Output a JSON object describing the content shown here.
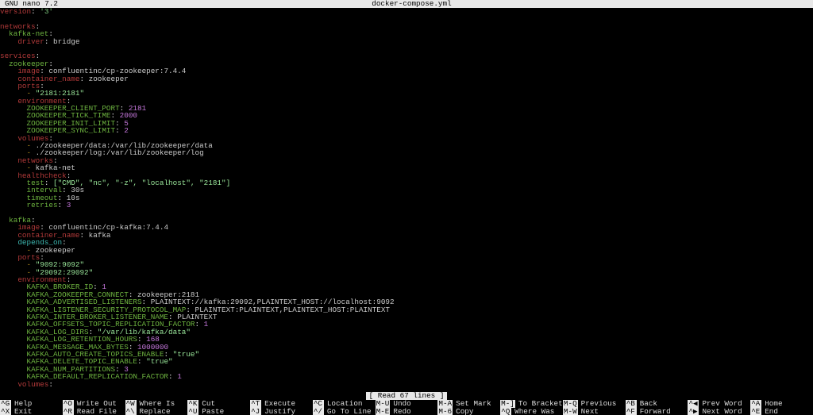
{
  "titlebar": {
    "app": "GNU nano 7.2",
    "filename": "docker-compose.yml"
  },
  "status": {
    "message": "[ Read 67 lines ]"
  },
  "shortcuts": {
    "row1": [
      {
        "key": "^G",
        "label": "Help"
      },
      {
        "key": "^O",
        "label": "Write Out"
      },
      {
        "key": "^W",
        "label": "Where Is"
      },
      {
        "key": "^K",
        "label": "Cut"
      },
      {
        "key": "^T",
        "label": "Execute"
      },
      {
        "key": "^C",
        "label": "Location"
      },
      {
        "key": "M-U",
        "label": "Undo"
      },
      {
        "key": "M-A",
        "label": "Set Mark"
      },
      {
        "key": "M-]",
        "label": "To Bracket"
      },
      {
        "key": "M-Q",
        "label": "Previous"
      },
      {
        "key": "^B",
        "label": "Back"
      },
      {
        "key": "^◀",
        "label": "Prev Word"
      },
      {
        "key": "^A",
        "label": "Home"
      }
    ],
    "row2": [
      {
        "key": "^X",
        "label": "Exit"
      },
      {
        "key": "^R",
        "label": "Read File"
      },
      {
        "key": "^\\",
        "label": "Replace"
      },
      {
        "key": "^U",
        "label": "Paste"
      },
      {
        "key": "^J",
        "label": "Justify"
      },
      {
        "key": "^/",
        "label": "Go To Line"
      },
      {
        "key": "M-E",
        "label": "Redo"
      },
      {
        "key": "M-6",
        "label": "Copy"
      },
      {
        "key": "^Q",
        "label": "Where Was"
      },
      {
        "key": "M-W",
        "label": "Next"
      },
      {
        "key": "^F",
        "label": "Forward"
      },
      {
        "key": "^▶",
        "label": "Next Word"
      },
      {
        "key": "^E",
        "label": "End"
      }
    ]
  },
  "lines": [
    {
      "t": "version: '3'",
      "key": "version",
      "sep": ": ",
      "val": "'3'",
      "kc": "k-red",
      "vc": "v-grn",
      "caret_after_key": true
    },
    {
      "t": ""
    },
    {
      "t": "networks:",
      "key": "networks",
      "sep": ":",
      "kc": "k-red"
    },
    {
      "t": "  kafka-net:",
      "indent": 2,
      "key": "kafka-net",
      "sep": ":",
      "kc": "k-green"
    },
    {
      "t": "    driver: bridge",
      "indent": 4,
      "key": "driver",
      "sep": ": ",
      "val": "bridge",
      "kc": "k-red",
      "vc": "v-plain"
    },
    {
      "t": ""
    },
    {
      "t": "services:",
      "key": "services",
      "sep": ":",
      "kc": "k-red"
    },
    {
      "t": "  zookeeper:",
      "indent": 2,
      "key": "zookeeper",
      "sep": ":",
      "kc": "k-green"
    },
    {
      "t": "    image: confluentinc/cp-zookeeper:7.4.4",
      "indent": 4,
      "key": "image",
      "sep": ": ",
      "val": "confluentinc/cp-zookeeper:7.4.4",
      "kc": "k-red",
      "vc": "v-plain"
    },
    {
      "t": "    container_name: zookeeper",
      "indent": 4,
      "key": "container_name",
      "sep": ": ",
      "val": "zookeeper",
      "kc": "k-red",
      "vc": "v-plain"
    },
    {
      "t": "    ports:",
      "indent": 4,
      "key": "ports",
      "sep": ":",
      "kc": "k-red"
    },
    {
      "t": "      - \"2181:2181\"",
      "indent": 6,
      "dash": true,
      "val": "\"2181:2181\"",
      "vc": "v-brg"
    },
    {
      "t": "    environment:",
      "indent": 4,
      "key": "environment",
      "sep": ":",
      "kc": "k-red"
    },
    {
      "t": "      ZOOKEEPER_CLIENT_PORT: 2181",
      "indent": 6,
      "key": "ZOOKEEPER_CLIENT_PORT",
      "sep": ": ",
      "val": "2181",
      "kc": "k-green",
      "vc": "v-magenta"
    },
    {
      "t": "      ZOOKEEPER_TICK_TIME: 2000",
      "indent": 6,
      "key": "ZOOKEEPER_TICK_TIME",
      "sep": ": ",
      "val": "2000",
      "kc": "k-green",
      "vc": "v-magenta"
    },
    {
      "t": "      ZOOKEEPER_INIT_LIMIT: 5",
      "indent": 6,
      "key": "ZOOKEEPER_INIT_LIMIT",
      "sep": ": ",
      "val": "5",
      "kc": "k-green",
      "vc": "v-magenta"
    },
    {
      "t": "      ZOOKEEPER_SYNC_LIMIT: 2",
      "indent": 6,
      "key": "ZOOKEEPER_SYNC_LIMIT",
      "sep": ": ",
      "val": "2",
      "kc": "k-green",
      "vc": "v-magenta"
    },
    {
      "t": "    volumes:",
      "indent": 4,
      "key": "volumes",
      "sep": ":",
      "kc": "k-red"
    },
    {
      "t": "      - ./zookeeper/data:/var/lib/zookeeper/data",
      "indent": 6,
      "dash": true,
      "val": "./zookeeper/data:/var/lib/zookeeper/data",
      "vc": "v-plain",
      "dc": "k-brown"
    },
    {
      "t": "      - ./zookeeper/log:/var/lib/zookeeper/log",
      "indent": 6,
      "dash": true,
      "val": "./zookeeper/log:/var/lib/zookeeper/log",
      "vc": "v-plain",
      "dc": "k-brown"
    },
    {
      "t": "    networks:",
      "indent": 4,
      "key": "networks",
      "sep": ":",
      "kc": "k-red"
    },
    {
      "t": "      - kafka-net",
      "indent": 6,
      "dash": true,
      "val": "kafka-net",
      "vc": "v-plain",
      "dc": "k-brown"
    },
    {
      "t": "    healthcheck:",
      "indent": 4,
      "key": "healthcheck",
      "sep": ":",
      "kc": "k-red"
    },
    {
      "t": "      test: [\"CMD\", \"nc\", \"-z\", \"localhost\", \"2181\"]",
      "indent": 6,
      "key": "test",
      "sep": ": ",
      "val": "[\"CMD\", \"nc\", \"-z\", \"localhost\", \"2181\"]",
      "kc": "k-green",
      "vc": "v-brg"
    },
    {
      "t": "      interval: 30s",
      "indent": 6,
      "key": "interval",
      "sep": ": ",
      "val": "30s",
      "kc": "k-green",
      "vc": "v-plain"
    },
    {
      "t": "      timeout: 10s",
      "indent": 6,
      "key": "timeout",
      "sep": ": ",
      "val": "10s",
      "kc": "k-green",
      "vc": "v-plain"
    },
    {
      "t": "      retries: 3",
      "indent": 6,
      "key": "retries",
      "sep": ": ",
      "val": "3",
      "kc": "k-green",
      "vc": "v-magenta"
    },
    {
      "t": ""
    },
    {
      "t": "  kafka:",
      "indent": 2,
      "key": "kafka",
      "sep": ":",
      "kc": "k-green"
    },
    {
      "t": "    image: confluentinc/cp-kafka:7.4.4",
      "indent": 4,
      "key": "image",
      "sep": ": ",
      "val": "confluentinc/cp-kafka:7.4.4",
      "kc": "k-red",
      "vc": "v-plain"
    },
    {
      "t": "    container_name: kafka",
      "indent": 4,
      "key": "container_name",
      "sep": ": ",
      "val": "kafka",
      "kc": "k-red",
      "vc": "v-plain"
    },
    {
      "t": "    depends_on:",
      "indent": 4,
      "key": "depends_on",
      "sep": ":",
      "kc": "k-cyan"
    },
    {
      "t": "      - zookeeper",
      "indent": 6,
      "dash": true,
      "val": "zookeeper",
      "vc": "v-plain",
      "dc": "k-brown"
    },
    {
      "t": "    ports:",
      "indent": 4,
      "key": "ports",
      "sep": ":",
      "kc": "k-red"
    },
    {
      "t": "      - \"9092:9092\"",
      "indent": 6,
      "dash": true,
      "val": "\"9092:9092\"",
      "vc": "v-brg"
    },
    {
      "t": "      - \"29092:29092\"",
      "indent": 6,
      "dash": true,
      "val": "\"29092:29092\"",
      "vc": "v-brg"
    },
    {
      "t": "    environment:",
      "indent": 4,
      "key": "environment",
      "sep": ":",
      "kc": "k-red"
    },
    {
      "t": "      KAFKA_BROKER_ID: 1",
      "indent": 6,
      "key": "KAFKA_BROKER_ID",
      "sep": ": ",
      "val": "1",
      "kc": "k-green",
      "vc": "v-magenta"
    },
    {
      "t": "      KAFKA_ZOOKEEPER_CONNECT: zookeeper:2181",
      "indent": 6,
      "key": "KAFKA_ZOOKEEPER_CONNECT",
      "sep": ": ",
      "val": "zookeeper:2181",
      "kc": "k-green",
      "vc": "v-plain"
    },
    {
      "t": "      KAFKA_ADVERTISED_LISTENERS: PLAINTEXT://kafka:29092,PLAINTEXT_HOST://localhost:9092",
      "indent": 6,
      "key": "KAFKA_ADVERTISED_LISTENERS",
      "sep": ": ",
      "val": "PLAINTEXT://kafka:29092,PLAINTEXT_HOST://localhost:9092",
      "kc": "k-green",
      "vc": "v-plain"
    },
    {
      "t": "      KAFKA_LISTENER_SECURITY_PROTOCOL_MAP: PLAINTEXT:PLAINTEXT,PLAINTEXT_HOST:PLAINTEXT",
      "indent": 6,
      "key": "KAFKA_LISTENER_SECURITY_PROTOCOL_MAP",
      "sep": ": ",
      "val": "PLAINTEXT:PLAINTEXT,PLAINTEXT_HOST:PLAINTEXT",
      "kc": "k-green",
      "vc": "v-plain"
    },
    {
      "t": "      KAFKA_INTER_BROKER_LISTENER_NAME: PLAINTEXT",
      "indent": 6,
      "key": "KAFKA_INTER_BROKER_LISTENER_NAME",
      "sep": ": ",
      "val": "PLAINTEXT",
      "kc": "k-green",
      "vc": "v-plain"
    },
    {
      "t": "      KAFKA_OFFSETS_TOPIC_REPLICATION_FACTOR: 1",
      "indent": 6,
      "key": "KAFKA_OFFSETS_TOPIC_REPLICATION_FACTOR",
      "sep": ": ",
      "val": "1",
      "kc": "k-green",
      "vc": "v-magenta"
    },
    {
      "t": "      KAFKA_LOG_DIRS: \"/var/lib/kafka/data\"",
      "indent": 6,
      "key": "KAFKA_LOG_DIRS",
      "sep": ": ",
      "val": "\"/var/lib/kafka/data\"",
      "kc": "k-green",
      "vc": "v-brg"
    },
    {
      "t": "      KAFKA_LOG_RETENTION_HOURS: 168",
      "indent": 6,
      "key": "KAFKA_LOG_RETENTION_HOURS",
      "sep": ": ",
      "val": "168",
      "kc": "k-green",
      "vc": "v-magenta"
    },
    {
      "t": "      KAFKA_MESSAGE_MAX_BYTES: 1000000",
      "indent": 6,
      "key": "KAFKA_MESSAGE_MAX_BYTES",
      "sep": ": ",
      "val": "1000000",
      "kc": "k-green",
      "vc": "v-magenta"
    },
    {
      "t": "      KAFKA_AUTO_CREATE_TOPICS_ENABLE: \"true\"",
      "indent": 6,
      "key": "KAFKA_AUTO_CREATE_TOPICS_ENABLE",
      "sep": ": ",
      "val": "\"true\"",
      "kc": "k-green",
      "vc": "v-brg"
    },
    {
      "t": "      KAFKA_DELETE_TOPIC_ENABLE: \"true\"",
      "indent": 6,
      "key": "KAFKA_DELETE_TOPIC_ENABLE",
      "sep": ": ",
      "val": "\"true\"",
      "kc": "k-green",
      "vc": "v-brg"
    },
    {
      "t": "      KAFKA_NUM_PARTITIONS: 3",
      "indent": 6,
      "key": "KAFKA_NUM_PARTITIONS",
      "sep": ": ",
      "val": "3",
      "kc": "k-green",
      "vc": "v-magenta"
    },
    {
      "t": "      KAFKA_DEFAULT_REPLICATION_FACTOR: 1",
      "indent": 6,
      "key": "KAFKA_DEFAULT_REPLICATION_FACTOR",
      "sep": ": ",
      "val": "1",
      "kc": "k-green",
      "vc": "v-magenta"
    },
    {
      "t": "    volumes:",
      "indent": 4,
      "key": "volumes",
      "sep": ":",
      "kc": "k-red"
    }
  ]
}
